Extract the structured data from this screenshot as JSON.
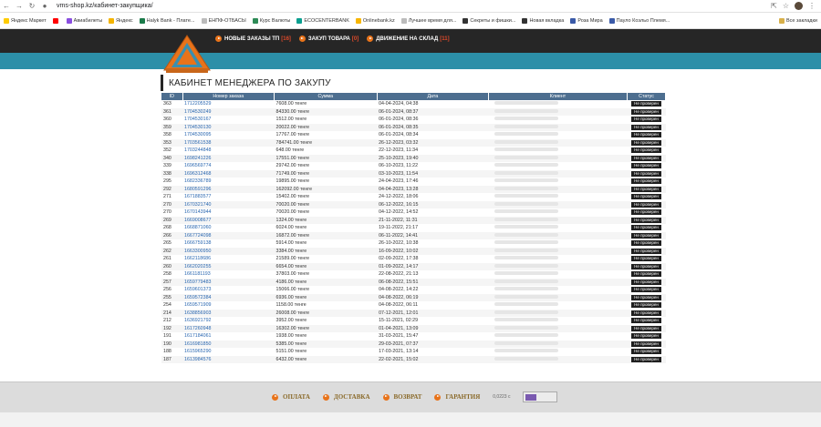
{
  "browser": {
    "url": "vms-shop.kz/кабинет-закупщика/",
    "bookmarks": [
      {
        "label": "Яндекс Маркет",
        "color": "#ffcc00"
      },
      {
        "label": "",
        "color": "#ff0000"
      },
      {
        "label": "Авиабилеты",
        "color": "#8a4ee0"
      },
      {
        "label": "Яндекс",
        "color": "#f4b400"
      },
      {
        "label": "Halyk Bank - Плате...",
        "color": "#1b7b4a"
      },
      {
        "label": "ЕНПФ-ОТБАСЫ",
        "color": "#bbbbbb"
      },
      {
        "label": "Курс Валюты",
        "color": "#2e8b57"
      },
      {
        "label": "ECOCENTERBANK",
        "color": "#0a9f8f"
      },
      {
        "label": "Onlinebank.kz",
        "color": "#f7b500"
      },
      {
        "label": "Лучшее время для...",
        "color": "#bbbbbb"
      },
      {
        "label": "Секреты и фишки...",
        "color": "#333333"
      },
      {
        "label": "Новая вкладка",
        "color": "#333333"
      },
      {
        "label": "Роза Мира",
        "color": "#3a5aa8"
      },
      {
        "label": "Пауло Коэльо Племя...",
        "color": "#3a5aa8"
      }
    ],
    "all_bookmarks": "Все закладки"
  },
  "site": {
    "nav": [
      {
        "label": "НОВЫЕ ЗАКАЗЫ ТП",
        "count": "[16]"
      },
      {
        "label": "ЗАКУП ТОВАРА",
        "count": "[0]"
      },
      {
        "label": "ДВИЖЕНИЕ НА СКЛАД",
        "count": "[11]"
      }
    ],
    "page_title": "КАБИНЕТ МЕНЕДЖЕРА ПО ЗАКУПУ"
  },
  "table": {
    "headers": [
      "ID",
      "Номер заказа",
      "Сумма",
      "Дата",
      "Клиент",
      "Статус"
    ],
    "rows": [
      {
        "id": "363",
        "num": "1712205529",
        "sum": "7608.00 тенге",
        "date": "04-04-2024, 04:38",
        "status": "Не проверен"
      },
      {
        "id": "361",
        "num": "1704530249",
        "sum": "84330.00 тенге",
        "date": "06-01-2024, 08:37",
        "status": "Не проверен"
      },
      {
        "id": "360",
        "num": "1704530167",
        "sum": "1512.00 тенге",
        "date": "06-01-2024, 08:36",
        "status": "Не проверен"
      },
      {
        "id": "359",
        "num": "1704530130",
        "sum": "20022.00 тенге",
        "date": "06-01-2024, 08:35",
        "status": "Не проверен"
      },
      {
        "id": "358",
        "num": "1704530095",
        "sum": "17767.00 тенге",
        "date": "06-01-2024, 08:34",
        "status": "Не проверен"
      },
      {
        "id": "353",
        "num": "1703561538",
        "sum": "784741.00 тенге",
        "date": "26-12-2023, 03:32",
        "status": "Не проверен"
      },
      {
        "id": "352",
        "num": "1703244848",
        "sum": "648.00 тенге",
        "date": "22-12-2023, 11:34",
        "status": "Не проверен"
      },
      {
        "id": "340",
        "num": "1698241226",
        "sum": "17551.00 тенге",
        "date": "25-10-2023, 19:40",
        "status": "Не проверен"
      },
      {
        "id": "339",
        "num": "1696569774",
        "sum": "29742.00 тенге",
        "date": "06-10-2023, 11:22",
        "status": "Не проверен"
      },
      {
        "id": "338",
        "num": "1696312468",
        "sum": "71749.00 тенге",
        "date": "03-10-2023, 11:54",
        "status": "Не проверен"
      },
      {
        "id": "295",
        "num": "1682336789",
        "sum": "19895.00 тенге",
        "date": "24-04-2023, 17:46",
        "status": "Не проверен"
      },
      {
        "id": "292",
        "num": "1680591296",
        "sum": "162092.00 тенге",
        "date": "04-04-2023, 13:28",
        "status": "Не проверен"
      },
      {
        "id": "271",
        "num": "1671883577",
        "sum": "15402.00 тенге",
        "date": "24-12-2022, 18:06",
        "status": "Не проверен"
      },
      {
        "id": "270",
        "num": "1670321740",
        "sum": "70020.00 тенге",
        "date": "06-12-2022, 16:15",
        "status": "Не проверен"
      },
      {
        "id": "270",
        "num": "1670143944",
        "sum": "70020.00 тенге",
        "date": "04-12-2022, 14:52",
        "status": "Не проверен"
      },
      {
        "id": "269",
        "num": "1669008677",
        "sum": "1324.00 тенге",
        "date": "21-11-2022, 11:31",
        "status": "Не проверен"
      },
      {
        "id": "268",
        "num": "1668871060",
        "sum": "6024.00 тенге",
        "date": "19-11-2022, 21:17",
        "status": "Не проверен"
      },
      {
        "id": "266",
        "num": "1667724098",
        "sum": "16872.00 тенге",
        "date": "06-11-2022, 14:41",
        "status": "Не проверен"
      },
      {
        "id": "265",
        "num": "1666759138",
        "sum": "5914.00 тенге",
        "date": "26-10-2022, 10:38",
        "status": "Не проверен"
      },
      {
        "id": "262",
        "num": "1663300950",
        "sum": "3384.00 тенге",
        "date": "16-09-2022, 10:02",
        "status": "Не проверен"
      },
      {
        "id": "261",
        "num": "1662118686",
        "sum": "21589.00 тенге",
        "date": "02-09-2022, 17:38",
        "status": "Не проверен"
      },
      {
        "id": "260",
        "num": "1662020255",
        "sum": "6654.00 тенге",
        "date": "01-09-2022, 14:17",
        "status": "Не проверен"
      },
      {
        "id": "258",
        "num": "1661181193",
        "sum": "37803.00 тенге",
        "date": "22-08-2022, 21:13",
        "status": "Не проверен"
      },
      {
        "id": "257",
        "num": "1659779483",
        "sum": "4186.00 тенге",
        "date": "06-08-2022, 15:51",
        "status": "Не проверен"
      },
      {
        "id": "256",
        "num": "1659601373",
        "sum": "15066.00 тенге",
        "date": "04-08-2022, 14:22",
        "status": "Не проверен"
      },
      {
        "id": "255",
        "num": "1659572384",
        "sum": "6936.00 тенге",
        "date": "04-08-2022, 06:19",
        "status": "Не проверен"
      },
      {
        "id": "254",
        "num": "1659571909",
        "sum": "1158.00 тенге",
        "date": "04-08-2022, 06:11",
        "status": "Не проверен"
      },
      {
        "id": "214",
        "num": "1638856903",
        "sum": "26008.00 тенге",
        "date": "07-12-2021, 12:01",
        "status": "Не проверен"
      },
      {
        "id": "212",
        "num": "1636921792",
        "sum": "3952.00 тенге",
        "date": "15-11-2021, 02:29",
        "status": "Не проверен"
      },
      {
        "id": "192",
        "num": "1617260948",
        "sum": "16302.00 тенге",
        "date": "01-04-2021, 13:09",
        "status": "Не проверен"
      },
      {
        "id": "191",
        "num": "1617184061",
        "sum": "1938.00 тенге",
        "date": "31-03-2021, 15:47",
        "status": "Не проверен"
      },
      {
        "id": "190",
        "num": "1616981850",
        "sum": "5385.00 тенге",
        "date": "29-03-2021, 07:37",
        "status": "Не проверен"
      },
      {
        "id": "188",
        "num": "1615965290",
        "sum": "5151.00 тенге",
        "date": "17-03-2021, 13:14",
        "status": "Не проверен"
      },
      {
        "id": "187",
        "num": "1613984576",
        "sum": "6432.00 тенге",
        "date": "22-02-2021, 15:02",
        "status": "Не проверен"
      }
    ]
  },
  "footer": {
    "nav": [
      "ОПЛАТА",
      "ДОСТАВКА",
      "ВОЗВРАТ",
      "ГАРАНТИЯ"
    ],
    "timing": "0,0223 с"
  }
}
